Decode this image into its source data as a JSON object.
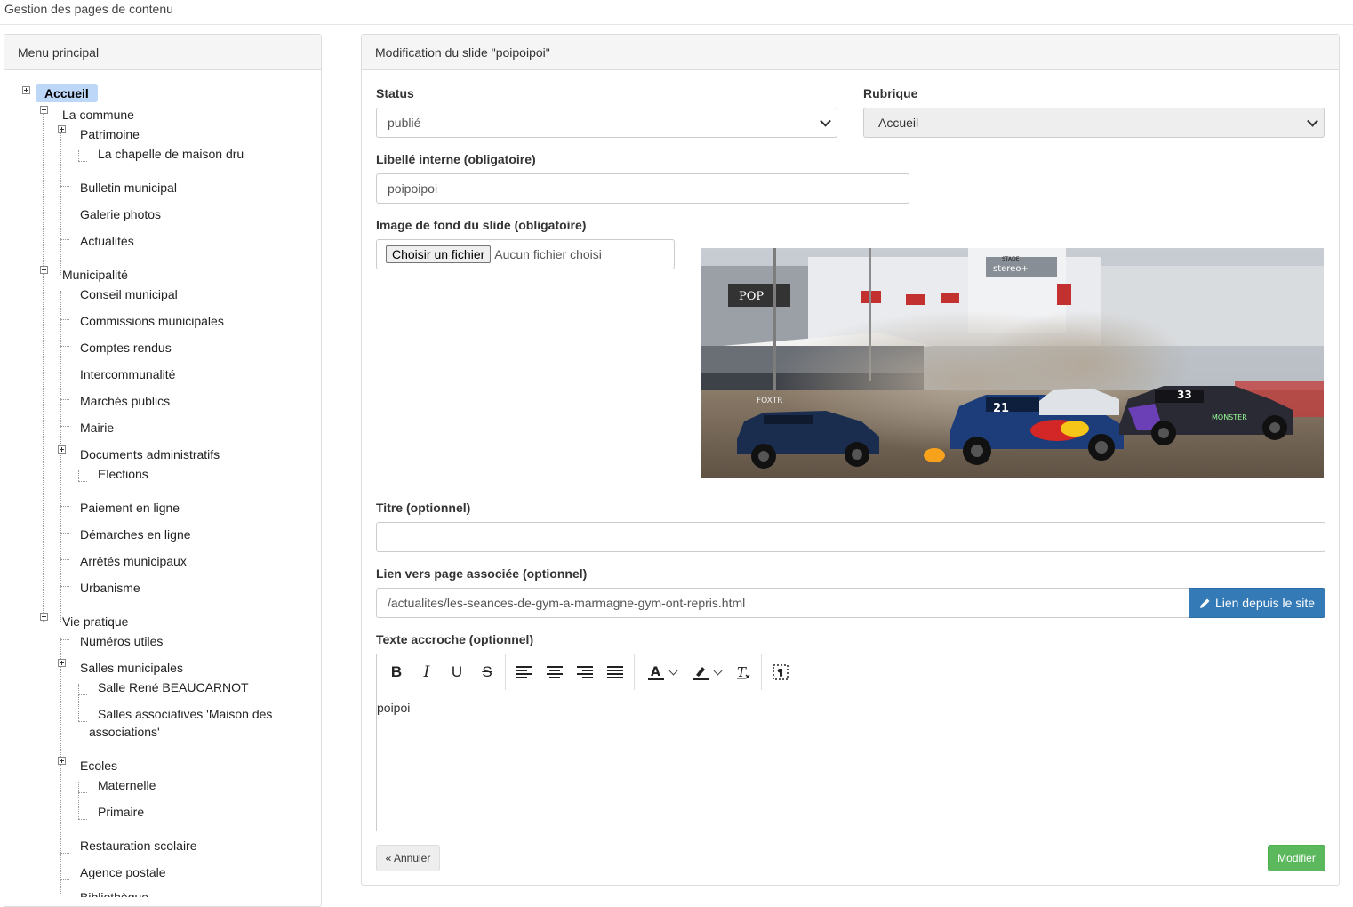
{
  "page": {
    "title": "Gestion des pages de contenu"
  },
  "left_panel": {
    "title": "Menu principal",
    "tree": [
      {
        "label": "Accueil"
      },
      {
        "label": "La commune"
      },
      {
        "label": "Patrimoine"
      },
      {
        "label": "La chapelle de maison dru"
      },
      {
        "label": "Bulletin municipal"
      },
      {
        "label": "Galerie photos"
      },
      {
        "label": "Actualités"
      },
      {
        "label": "Municipalité"
      },
      {
        "label": "Conseil municipal"
      },
      {
        "label": "Commissions municipales"
      },
      {
        "label": "Comptes rendus"
      },
      {
        "label": "Intercommunalité"
      },
      {
        "label": "Marchés publics"
      },
      {
        "label": "Mairie"
      },
      {
        "label": "Documents administratifs"
      },
      {
        "label": "Elections"
      },
      {
        "label": "Paiement en ligne"
      },
      {
        "label": "Démarches en ligne"
      },
      {
        "label": "Arrêtés municipaux"
      },
      {
        "label": "Urbanisme"
      },
      {
        "label": "Vie pratique"
      },
      {
        "label": "Numéros utiles"
      },
      {
        "label": "Salles municipales"
      },
      {
        "label": "Salle René BEAUCARNOT"
      },
      {
        "label": "Salles associatives 'Maison des"
      },
      {
        "label": "associations'"
      },
      {
        "label": "Ecoles"
      },
      {
        "label": "Maternelle"
      },
      {
        "label": "Primaire"
      },
      {
        "label": "Restauration scolaire"
      },
      {
        "label": "Agence postale"
      },
      {
        "label": "Bibliothèque"
      }
    ]
  },
  "form": {
    "title": "Modification du slide \"poipoipoi\"",
    "status": {
      "label": "Status",
      "value": "publié"
    },
    "rubrique": {
      "label": "Rubrique",
      "value": "Accueil"
    },
    "libelle": {
      "label": "Libellé interne (obligatoire)",
      "value": "poipoipoi"
    },
    "image": {
      "label": "Image de fond du slide (obligatoire)",
      "button": "Choisir un fichier",
      "status": "Aucun fichier choisi"
    },
    "titre": {
      "label": "Titre (optionnel)",
      "value": ""
    },
    "lien": {
      "label": "Lien vers page associée (optionnel)",
      "value": "/actualites/les-seances-de-gym-a-marmagne-gym-ont-repris.html",
      "button": "Lien depuis le site"
    },
    "accroche": {
      "label": "Texte accroche (optionnel)",
      "value": "poipoi"
    },
    "cancel": "« Annuler",
    "submit": "Modifier"
  },
  "photo": {
    "signs": [
      "POP",
      "stereo+",
      "STADE",
      "FOXTR",
      "21",
      "33",
      "MONSTER"
    ]
  },
  "colors": {
    "primary": "#337ab7",
    "success": "#5cb85c",
    "selected": "#bcd7f7"
  },
  "toolbar_icons": [
    "bold-icon",
    "italic-icon",
    "underline-icon",
    "strikethrough-icon",
    "align-left-icon",
    "align-center-icon",
    "align-right-icon",
    "align-justify-icon",
    "text-color-icon",
    "highlight-icon",
    "clear-format-icon",
    "show-blocks-icon"
  ]
}
